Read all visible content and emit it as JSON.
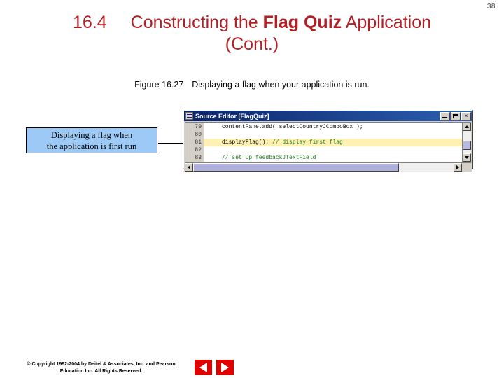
{
  "page": {
    "number": "38"
  },
  "title": {
    "section_number": "16.4",
    "line1_pre": "Constructing the ",
    "line1_strong": "Flag Quiz",
    "line1_post": " Application",
    "line2": "(Cont.)",
    "color": "#B11F24"
  },
  "figure": {
    "label": "Figure 16.27",
    "caption": "Displaying a flag when your application is run."
  },
  "callout": {
    "line1": "Displaying a flag when",
    "line2": "the application is first run",
    "bg_color": "#9CC9F5"
  },
  "editor": {
    "title": "Source Editor [FlagQuiz]",
    "titlebar_icon": "source-editor-icon",
    "window_buttons": [
      {
        "name": "minimize-button",
        "glyph": ""
      },
      {
        "name": "maximize-button",
        "glyph": ""
      },
      {
        "name": "close-button",
        "glyph": "×"
      }
    ],
    "lines": [
      {
        "number": "79",
        "code": "contentPane.add( selectCountryJComboBox );",
        "highlighted": false,
        "comment": ""
      },
      {
        "number": "80",
        "code": "",
        "highlighted": false,
        "comment": ""
      },
      {
        "number": "81",
        "code": "displayFlag(); ",
        "comment": "// display first flag",
        "highlighted": true
      },
      {
        "number": "82",
        "code": "",
        "highlighted": false,
        "comment": ""
      },
      {
        "number": "83",
        "code": "",
        "comment": "// set up feedbackJTextField",
        "highlighted": false
      }
    ],
    "highlight_color": "#FFF0B3",
    "comment_color": "#1B7A1B",
    "scroll": {
      "vertical_up": "scroll-up-arrow",
      "vertical_down": "scroll-down-arrow",
      "horizontal_left": "scroll-left-arrow",
      "horizontal_right": "scroll-right-arrow"
    }
  },
  "footer": {
    "copyright_line1": "© Copyright 1992-2004 by Deitel & Associates, Inc. and Pearson",
    "copyright_line2": "Education Inc. All Rights Reserved.",
    "nav_prev": "previous-slide-button",
    "nav_next": "next-slide-button",
    "nav_color": "#E00000"
  }
}
